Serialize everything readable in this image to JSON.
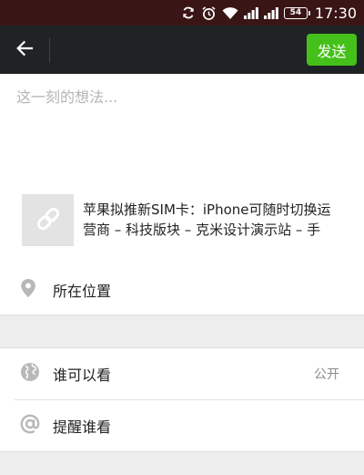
{
  "status_bar": {
    "time": "17:30",
    "battery": "54",
    "icons": [
      "sync-icon",
      "alarm-icon",
      "wifi-icon",
      "signal-icon",
      "signal-icon",
      "battery-icon"
    ]
  },
  "app_bar": {
    "back_icon": "arrow-left-icon",
    "send_label": "发送",
    "send_color": "#45c01a"
  },
  "compose": {
    "placeholder": "这一刻的想法..."
  },
  "link_card": {
    "thumb_icon": "link-icon",
    "title": "苹果拟推新SIM卡：iPhone可随时切换运营商 – 科技版块 – 克米设计演示站 – 手"
  },
  "options": {
    "location": {
      "icon": "location-pin-icon",
      "label": "所在位置"
    },
    "visibility": {
      "icon": "globe-icon",
      "label": "谁可以看",
      "value": "公开"
    },
    "mention": {
      "icon": "at-sign-icon",
      "label": "提醒谁看"
    }
  }
}
